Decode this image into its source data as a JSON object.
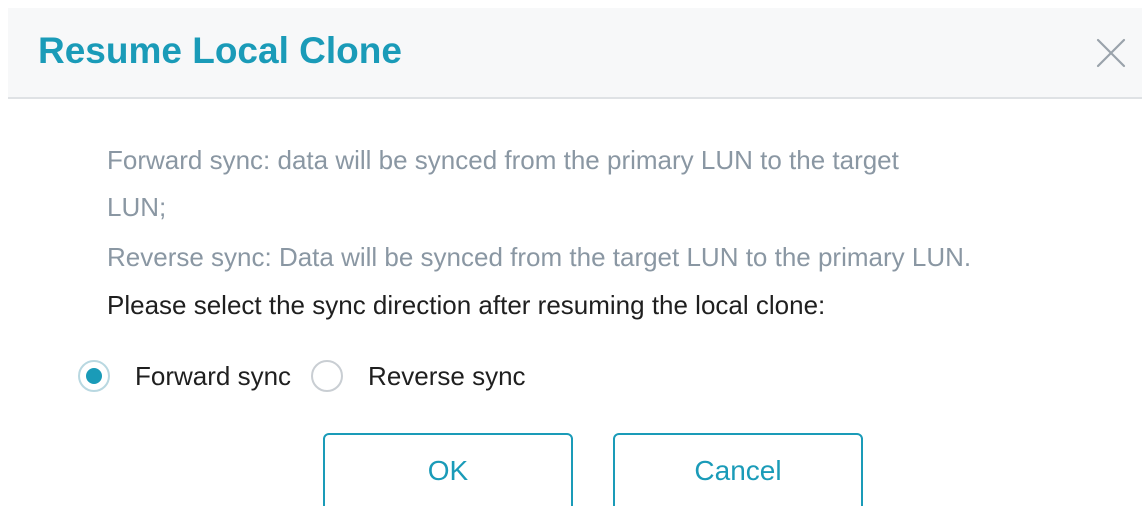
{
  "dialog": {
    "title": "Resume Local Clone",
    "close_icon": "close-icon",
    "description": {
      "forward_line1": "Forward sync: data will be synced from the primary LUN to the target",
      "forward_line2": "LUN;",
      "reverse": "Reverse sync: Data will be synced from the target LUN to the primary LUN."
    },
    "prompt": "Please select the sync direction after resuming the local clone:",
    "options": [
      {
        "label": "Forward sync",
        "selected": true
      },
      {
        "label": "Reverse sync",
        "selected": false
      }
    ],
    "buttons": {
      "ok": "OK",
      "cancel": "Cancel"
    }
  },
  "colors": {
    "accent": "#1a9bb8",
    "description_text": "#8a97a3",
    "body_text": "#1f1f1f",
    "header_bg": "#f7f8f9"
  }
}
